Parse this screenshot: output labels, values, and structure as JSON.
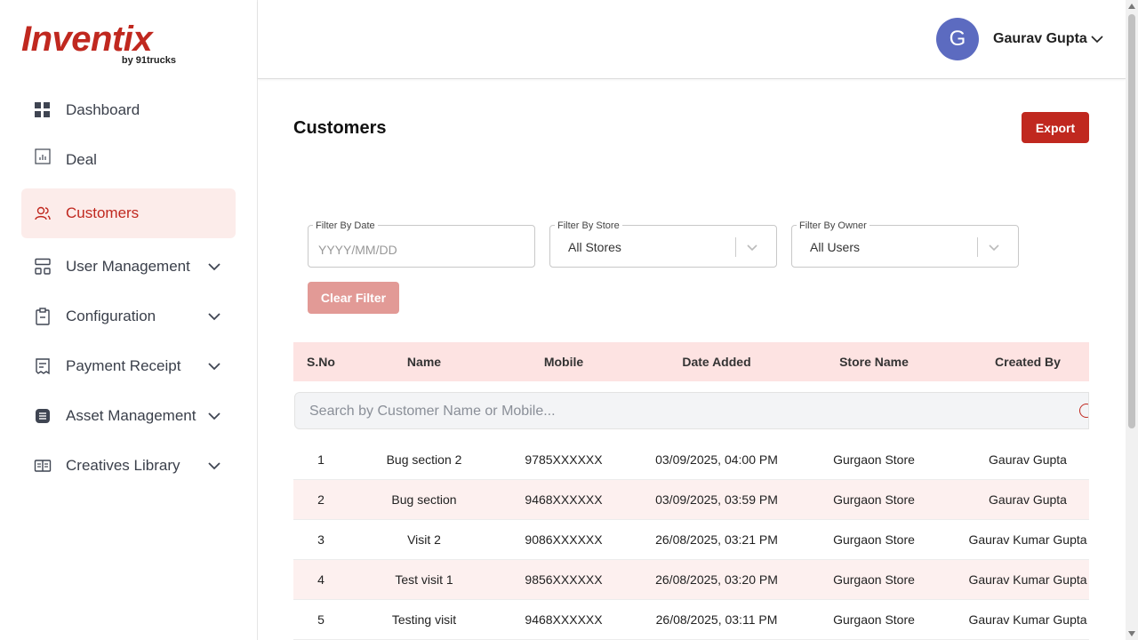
{
  "brand": {
    "name": "Inventix",
    "sub": "by 91trucks",
    "color": "#c0281f"
  },
  "sidebar": {
    "items": [
      {
        "label": "Dashboard",
        "icon": "grid-icon",
        "active": false,
        "expandable": false
      },
      {
        "label": "Deal",
        "icon": "chart-icon",
        "active": false,
        "expandable": false
      },
      {
        "label": "Customers",
        "icon": "users-icon",
        "active": true,
        "expandable": false
      },
      {
        "label": "User Management",
        "icon": "sitemap-icon",
        "active": false,
        "expandable": true
      },
      {
        "label": "Configuration",
        "icon": "clipboard-icon",
        "active": false,
        "expandable": true
      },
      {
        "label": "Payment Receipt",
        "icon": "receipt-icon",
        "active": false,
        "expandable": true
      },
      {
        "label": "Asset Management",
        "icon": "asset-icon",
        "active": false,
        "expandable": true
      },
      {
        "label": "Creatives Library",
        "icon": "library-icon",
        "active": false,
        "expandable": true
      }
    ]
  },
  "header": {
    "avatar_letter": "G",
    "user_name": "Gaurav Gupta",
    "avatar_color": "#5c6bc0"
  },
  "page": {
    "title": "Customers",
    "export_label": "Export"
  },
  "filters": {
    "date": {
      "label": "Filter By Date",
      "placeholder": "YYYY/MM/DD"
    },
    "store": {
      "label": "Filter By Store",
      "value": "All Stores"
    },
    "owner": {
      "label": "Filter By Owner",
      "value": "All Users"
    },
    "clear_label": "Clear Filter"
  },
  "table": {
    "columns": [
      "S.No",
      "Name",
      "Mobile",
      "Date Added",
      "Store Name",
      "Created By"
    ],
    "search_placeholder": "Search by Customer Name or Mobile...",
    "rows": [
      [
        "1",
        "Bug section 2",
        "9785XXXXXX",
        "03/09/2025, 04:00 PM",
        "Gurgaon Store",
        "Gaurav Gupta"
      ],
      [
        "2",
        "Bug section",
        "9468XXXXXX",
        "03/09/2025, 03:59 PM",
        "Gurgaon Store",
        "Gaurav Gupta"
      ],
      [
        "3",
        "Visit 2",
        "9086XXXXXX",
        "26/08/2025, 03:21 PM",
        "Gurgaon Store",
        "Gaurav Kumar Gupta"
      ],
      [
        "4",
        "Test visit 1",
        "9856XXXXXX",
        "26/08/2025, 03:20 PM",
        "Gurgaon Store",
        "Gaurav Kumar Gupta"
      ],
      [
        "5",
        "Testing visit",
        "9468XXXXXX",
        "26/08/2025, 03:11 PM",
        "Gurgaon Store",
        "Gaurav Kumar Gupta"
      ]
    ]
  }
}
